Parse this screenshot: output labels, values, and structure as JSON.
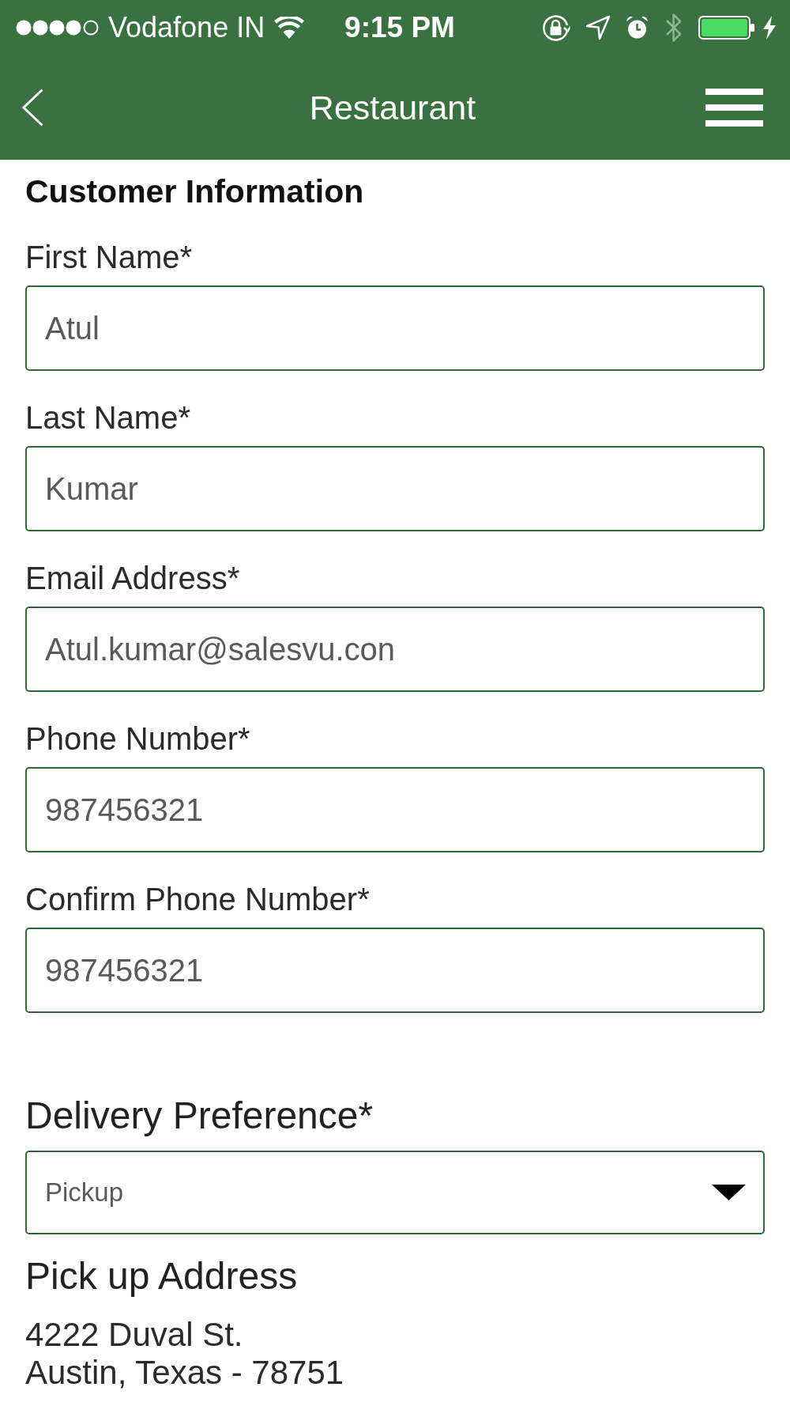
{
  "status_bar": {
    "carrier": "Vodafone IN",
    "time": "9:15 PM",
    "bluetooth_connected": false,
    "charging": true
  },
  "nav_bar": {
    "title": "Restaurant"
  },
  "customer_form": {
    "heading": "Customer Information",
    "fields": [
      {
        "label": "First Name*",
        "value": "Atul"
      },
      {
        "label": "Last Name*",
        "value": "Kumar"
      },
      {
        "label": "Email Address*",
        "value": "Atul.kumar@salesvu.con"
      },
      {
        "label": "Phone Number*",
        "value": "987456321"
      },
      {
        "label": "Confirm Phone Number*",
        "value": "987456321"
      }
    ]
  },
  "delivery_preference": {
    "label": "Delivery Preference*",
    "value": "Pickup"
  },
  "pickup_address": {
    "heading": "Pick up Address",
    "lines": [
      "4222 Duval St.",
      "Austin, Texas - 78751"
    ]
  }
}
